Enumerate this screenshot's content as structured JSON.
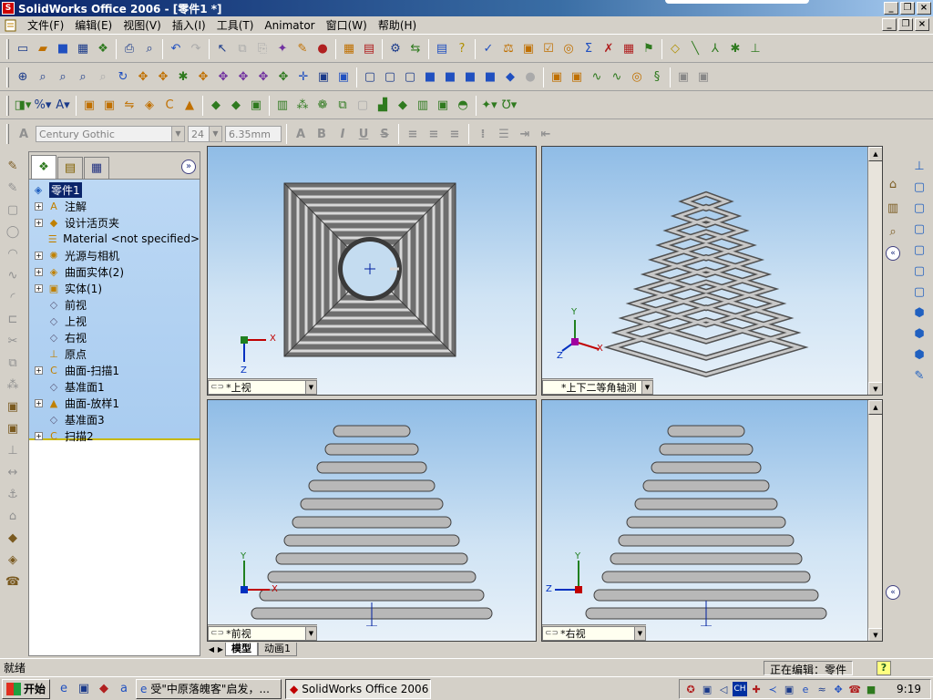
{
  "window": {
    "title": "SolidWorks Office 2006 - [零件1 *]",
    "minimize": "_",
    "restore": "❐",
    "close": "×"
  },
  "menu": [
    "文件(F)",
    "编辑(E)",
    "视图(V)",
    "插入(I)",
    "工具(T)",
    "Animator",
    "窗口(W)",
    "帮助(H)"
  ],
  "fontbar": {
    "font": "Century Gothic",
    "size": "24",
    "height": "6.35mm"
  },
  "feature_tree": {
    "root": "零件1",
    "items": [
      {
        "label": "注解",
        "expand": true,
        "icon": "annotation-icon",
        "glyph": "A"
      },
      {
        "label": "设计活页夹",
        "expand": true,
        "icon": "design-binder-icon",
        "glyph": "◆"
      },
      {
        "label": "Material <not specified>",
        "expand": false,
        "icon": "material-icon",
        "glyph": "☰"
      },
      {
        "label": "光源与相机",
        "expand": true,
        "icon": "lights-camera-icon",
        "glyph": "✺"
      },
      {
        "label": "曲面实体(2)",
        "expand": true,
        "icon": "surface-bodies-icon",
        "glyph": "◈"
      },
      {
        "label": "实体(1)",
        "expand": true,
        "icon": "solid-bodies-icon",
        "glyph": "▣"
      },
      {
        "label": "前视",
        "expand": false,
        "icon": "plane-icon",
        "glyph": "◇"
      },
      {
        "label": "上视",
        "expand": false,
        "icon": "plane-icon",
        "glyph": "◇"
      },
      {
        "label": "右视",
        "expand": false,
        "icon": "plane-icon",
        "glyph": "◇"
      },
      {
        "label": "原点",
        "expand": false,
        "icon": "origin-icon",
        "glyph": "⊥"
      },
      {
        "label": "曲面-扫描1",
        "expand": true,
        "icon": "sweep-surface-icon",
        "glyph": "C"
      },
      {
        "label": "基准面1",
        "expand": false,
        "icon": "plane-icon",
        "glyph": "◇"
      },
      {
        "label": "曲面-放样1",
        "expand": true,
        "icon": "loft-surface-icon",
        "glyph": "▲"
      },
      {
        "label": "基准面3",
        "expand": false,
        "icon": "plane-icon",
        "glyph": "◇"
      },
      {
        "label": "扫描2",
        "expand": true,
        "icon": "sweep-icon",
        "glyph": "C"
      }
    ]
  },
  "viewports": {
    "top": "*上视",
    "iso": "*上下二等角轴测",
    "front": "*前视",
    "right": "*右视"
  },
  "axes": {
    "x": "X",
    "y": "Y",
    "z": "Z"
  },
  "tabs": {
    "model": "模型",
    "animation": "动画1"
  },
  "status": {
    "ready": "就绪",
    "editing": "正在编辑：零件",
    "help": "?"
  },
  "taskbar": {
    "start": "开始",
    "tasks": [
      "受\"中原落魄客\"启发，...",
      "SolidWorks Office 2006 - ..."
    ],
    "time": "9:19",
    "ime": "CH"
  }
}
